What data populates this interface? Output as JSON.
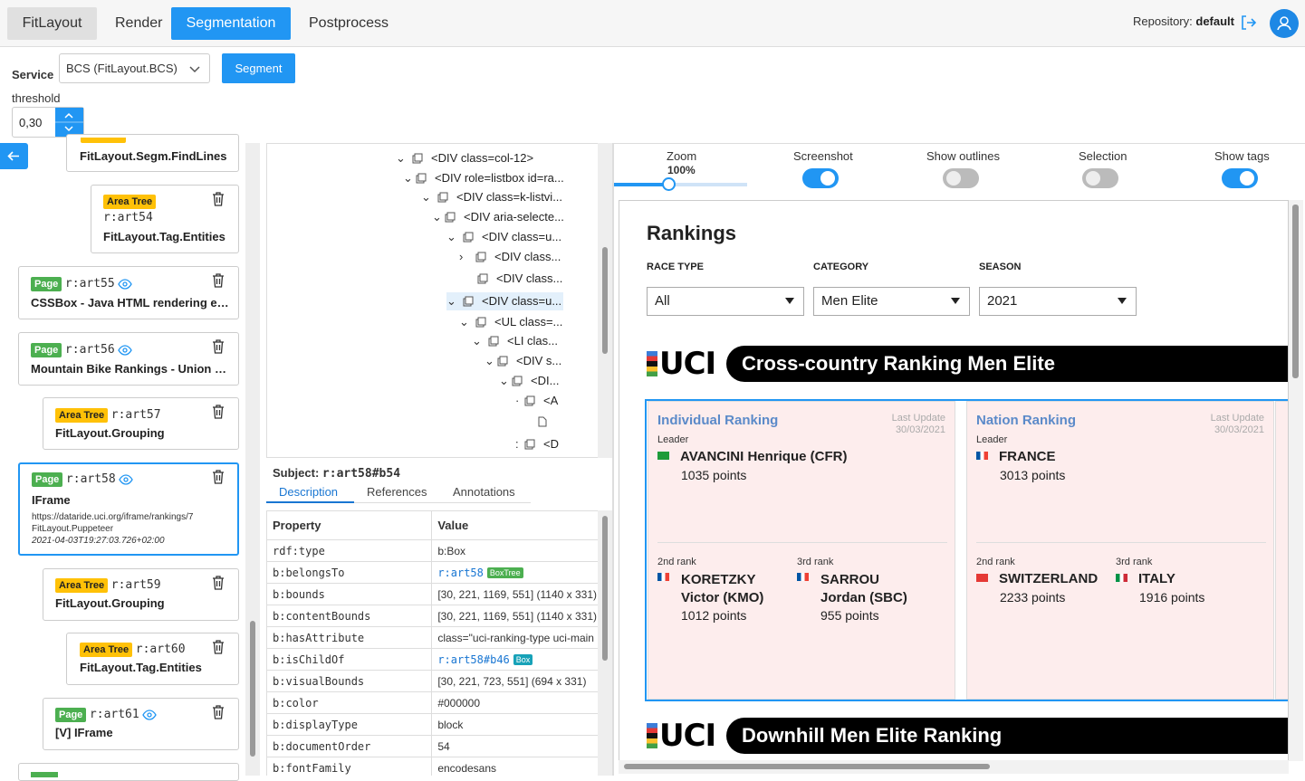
{
  "nav": {
    "brand": "FitLayout",
    "items": [
      "Render",
      "Segmentation",
      "Postprocess"
    ],
    "repo_label": "Repository:",
    "repo_name": "default"
  },
  "service": {
    "label": "Service",
    "value": "BCS (FitLayout.BCS)",
    "segment_button": "Segment",
    "threshold_label": "threshold",
    "threshold_value": "0,30"
  },
  "artifacts": [
    {
      "type": "",
      "id": "",
      "title": "FitLayout.Segm.FindLines"
    },
    {
      "type": "Area Tree",
      "id": "r:art54",
      "title": "FitLayout.Tag.Entities"
    },
    {
      "type": "Page",
      "id": "r:art55",
      "title": "CSSBox - Java HTML rendering en..."
    },
    {
      "type": "Page",
      "id": "r:art56",
      "title": "Mountain Bike Rankings - Union C..."
    },
    {
      "type": "Area Tree",
      "id": "r:art57",
      "title": "FitLayout.Grouping"
    },
    {
      "type": "Page",
      "id": "r:art58",
      "title": "IFrame",
      "url": "https://dataride.uci.org/iframe/rankings/7",
      "creator": "FitLayout.Puppeteer",
      "date": "2021-04-03T19:27:03.726+02:00"
    },
    {
      "type": "Area Tree",
      "id": "r:art59",
      "title": "FitLayout.Grouping"
    },
    {
      "type": "Area Tree",
      "id": "r:art60",
      "title": "FitLayout.Tag.Entities"
    },
    {
      "type": "Page",
      "id": "r:art61",
      "title": "[V] IFrame"
    }
  ],
  "tree": [
    "<DIV class=col-12>",
    "<DIV role=listbox id=ra...",
    "<DIV class=k-listvi...",
    "<DIV aria-selecte...",
    "<DIV class=u...",
    "<DIV class...",
    "<DIV class...",
    "<DIV class=u...",
    "<UL class=...",
    "<LI clas...",
    "<DIV s...",
    "<DI...",
    "<A",
    "",
    "<D"
  ],
  "subject": {
    "label": "Subject:",
    "value": "r:art58#b54"
  },
  "tabs": [
    "Description",
    "References",
    "Annotations"
  ],
  "props": {
    "headers": [
      "Property",
      "Value"
    ],
    "rows": [
      {
        "p": "rdf:type",
        "v": "b:Box"
      },
      {
        "p": "b:belongsTo",
        "v": "r:art58",
        "tag": "BoxTree"
      },
      {
        "p": "b:bounds",
        "v": "[30, 221, 1169, 551] (1140 x 331)"
      },
      {
        "p": "b:contentBounds",
        "v": "[30, 221, 1169, 551] (1140 x 331)"
      },
      {
        "p": "b:hasAttribute",
        "v": "class=\"uci-ranking-type uci-main"
      },
      {
        "p": "b:isChildOf",
        "v": "r:art58#b46",
        "tag": "Box"
      },
      {
        "p": "b:visualBounds",
        "v": "[30, 221, 723, 551] (694 x 331)"
      },
      {
        "p": "b:color",
        "v": "#000000"
      },
      {
        "p": "b:displayType",
        "v": "block"
      },
      {
        "p": "b:documentOrder",
        "v": "54"
      },
      {
        "p": "b:fontFamily",
        "v": "encodesans"
      }
    ]
  },
  "view": {
    "zoom_label": "Zoom",
    "zoom_value": "100%",
    "zoom_level": 0.45,
    "screenshot": "Screenshot",
    "outlines": "Show outlines",
    "selection": "Selection",
    "tags": "Show tags"
  },
  "preview": {
    "title": "Rankings",
    "filters": [
      {
        "label": "RACE TYPE",
        "value": "All"
      },
      {
        "label": "CATEGORY",
        "value": "Men Elite"
      },
      {
        "label": "SEASON",
        "value": "2021"
      }
    ],
    "logo": "UCI",
    "banner1": "Cross-country Ranking Men Elite",
    "banner2": "Downhill Men Elite Ranking",
    "individual": {
      "title": "Individual Ranking",
      "lu": "Last Update",
      "date": "30/03/2021",
      "leader_lbl": "Leader",
      "leader": "AVANCINI Henrique (CFR)",
      "leader_pts": "1035 points",
      "r2_lbl": "2nd rank",
      "r2a": "KORETZKY",
      "r2b": "Victor (KMO)",
      "r2_pts": "1012 points",
      "r3_lbl": "3rd rank",
      "r3a": "SARROU",
      "r3b": "Jordan (SBC)",
      "r3_pts": "955 points"
    },
    "nation": {
      "title": "Nation Ranking",
      "lu": "Last Update",
      "date": "30/03/2021",
      "leader_lbl": "Leader",
      "leader": "FRANCE",
      "leader_pts": "3013 points",
      "r2_lbl": "2nd rank",
      "r2": "SWITZERLAND",
      "r2_pts": "2233 points",
      "r3_lbl": "3rd rank",
      "r3": "ITALY",
      "r3_pts": "1916 points"
    }
  },
  "colors": {
    "accent": "#2196f3",
    "page_badge": "#4caf50",
    "area_badge": "#ffc107"
  }
}
